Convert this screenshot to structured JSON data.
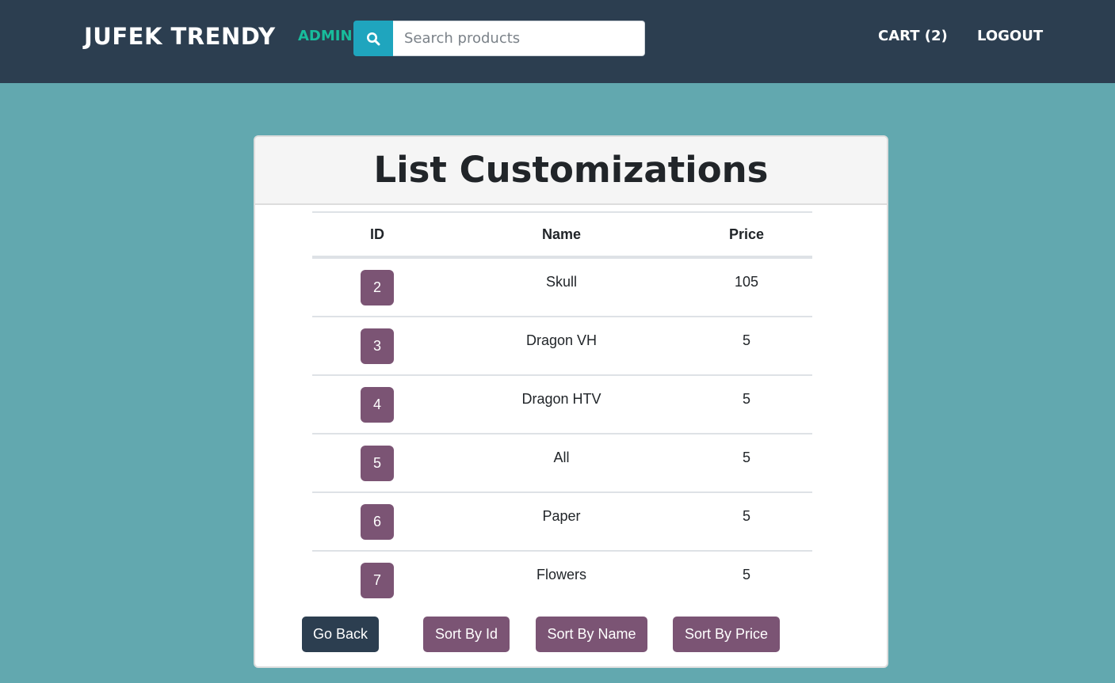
{
  "navbar": {
    "brand": "JUFEK TRENDY",
    "admin_label": "ADMIN",
    "search": {
      "icon": "search-icon",
      "placeholder": "Search products",
      "value": ""
    },
    "cart_label": "CART (2)",
    "logout_label": "LOGOUT"
  },
  "card": {
    "title": "List Customizations",
    "table": {
      "headers": [
        "ID",
        "Name",
        "Price"
      ],
      "rows": [
        {
          "id": "2",
          "name": "Skull",
          "price": "105"
        },
        {
          "id": "3",
          "name": "Dragon VH",
          "price": "5"
        },
        {
          "id": "4",
          "name": "Dragon HTV",
          "price": "5"
        },
        {
          "id": "5",
          "name": "All",
          "price": "5"
        },
        {
          "id": "6",
          "name": "Paper",
          "price": "5"
        },
        {
          "id": "7",
          "name": "Flowers",
          "price": "5"
        }
      ]
    },
    "buttons": {
      "go_back": "Go Back",
      "sort_by_id": "Sort By Id",
      "sort_by_name": "Sort By Name",
      "sort_by_price": "Sort By Price"
    }
  },
  "colors": {
    "navbar_bg": "#2c3e50",
    "page_bg": "#62a8af",
    "admin_accent": "#18bc9c",
    "search_button": "#1fa5be",
    "badge_and_sort_buttons": "#7b5474",
    "go_back_button": "#2c3e50"
  }
}
